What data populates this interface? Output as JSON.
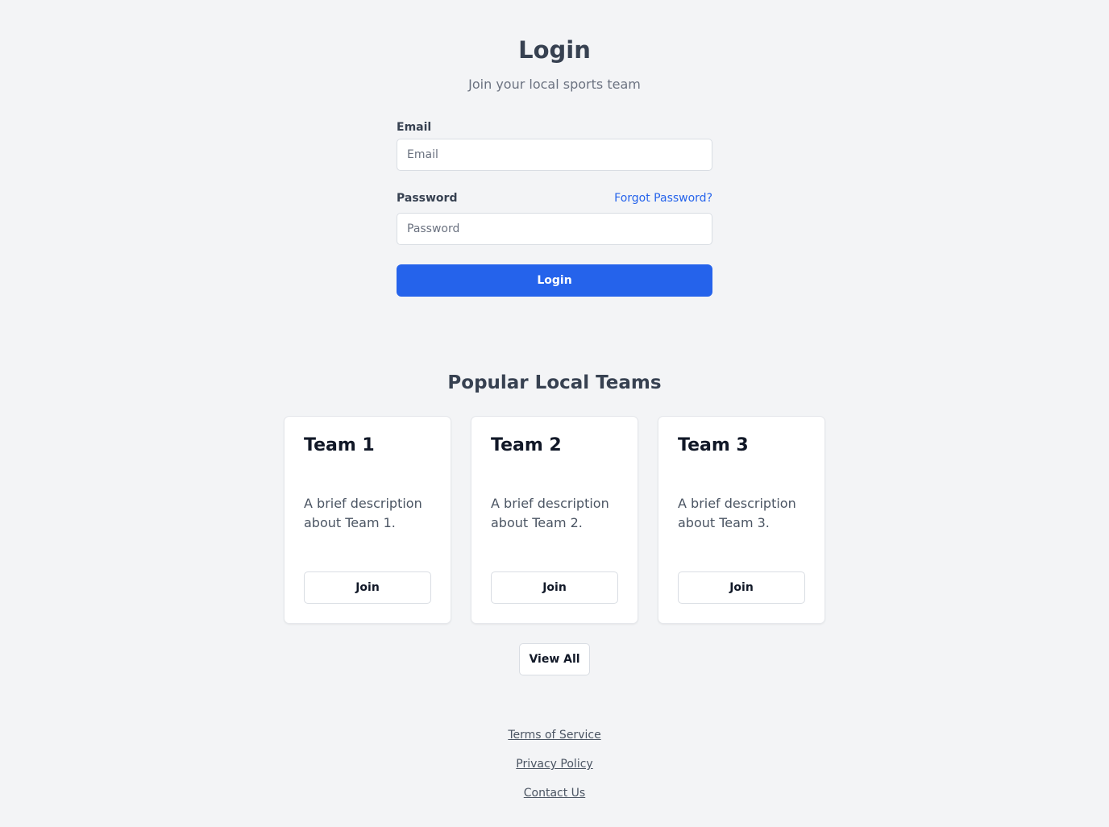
{
  "login": {
    "title": "Login",
    "subtitle": "Join your local sports team",
    "email_label": "Email",
    "email_placeholder": "Email",
    "email_value": "",
    "password_label": "Password",
    "password_placeholder": "Password",
    "password_value": "",
    "forgot_password": "Forgot Password?",
    "submit_label": "Login"
  },
  "teams": {
    "title": "Popular Local Teams",
    "items": [
      {
        "name": "Team 1",
        "description": "A brief description about Team 1.",
        "join_label": "Join"
      },
      {
        "name": "Team 2",
        "description": "A brief description about Team 2.",
        "join_label": "Join"
      },
      {
        "name": "Team 3",
        "description": "A brief description about Team 3.",
        "join_label": "Join"
      }
    ],
    "view_all_label": "View All"
  },
  "footer": {
    "links": [
      "Terms of Service",
      "Privacy Policy",
      "Contact Us"
    ]
  },
  "colors": {
    "background": "#f3f4f6",
    "primary": "#2563eb",
    "heading": "#374151",
    "muted": "#6b7280"
  }
}
